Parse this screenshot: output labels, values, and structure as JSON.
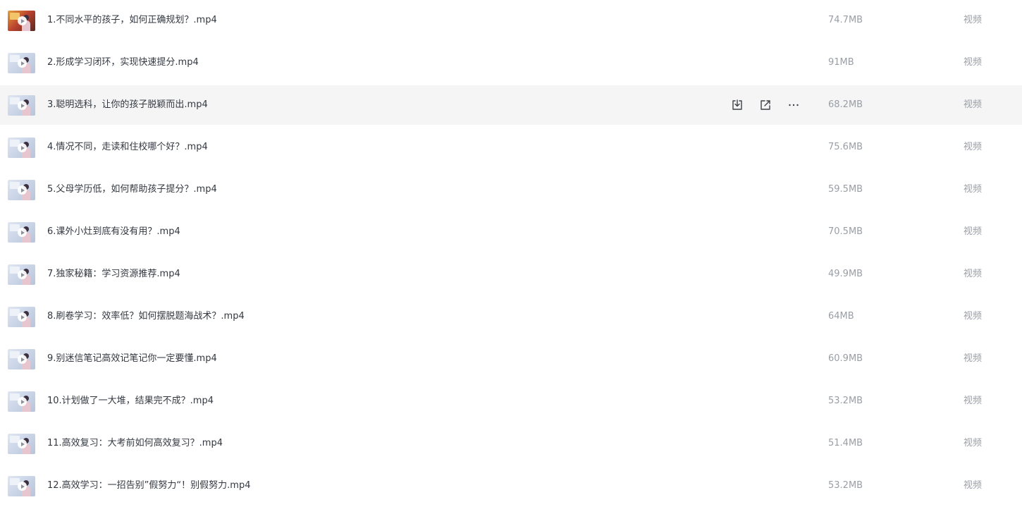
{
  "files": [
    {
      "name": "1.不同水平的孩子，如何正确规划？.mp4",
      "size": "74.7MB",
      "type": "视频",
      "thumb": "warm"
    },
    {
      "name": "2.形成学习闭环，实现快速提分.mp4",
      "size": "91MB",
      "type": "视频",
      "thumb": "cool"
    },
    {
      "name": "3.聪明选科，让你的孩子脱颖而出.mp4",
      "size": "68.2MB",
      "type": "视频",
      "thumb": "cool"
    },
    {
      "name": "4.情况不同，走读和住校哪个好？.mp4",
      "size": "75.6MB",
      "type": "视频",
      "thumb": "cool"
    },
    {
      "name": "5.父母学历低，如何帮助孩子提分？.mp4",
      "size": "59.5MB",
      "type": "视频",
      "thumb": "cool"
    },
    {
      "name": "6.课外小灶到底有没有用？.mp4",
      "size": "70.5MB",
      "type": "视频",
      "thumb": "cool"
    },
    {
      "name": "7.独家秘籍：学习资源推荐.mp4",
      "size": "49.9MB",
      "type": "视频",
      "thumb": "cool"
    },
    {
      "name": "8.刷卷学习：效率低？如何摆脱题海战术？.mp4",
      "size": "64MB",
      "type": "视频",
      "thumb": "cool"
    },
    {
      "name": "9.别迷信笔记高效记笔记你一定要懂.mp4",
      "size": "60.9MB",
      "type": "视频",
      "thumb": "cool"
    },
    {
      "name": "10.计划做了一大堆，结果完不成？.mp4",
      "size": "53.2MB",
      "type": "视频",
      "thumb": "cool"
    },
    {
      "name": "11.高效复习：大考前如何高效复习？.mp4",
      "size": "51.4MB",
      "type": "视频",
      "thumb": "cool"
    },
    {
      "name": "12.高效学习：一招告别”假努力“！别假努力.mp4",
      "size": "53.2MB",
      "type": "视频",
      "thumb": "cool"
    }
  ],
  "hovered_row": 2,
  "row_actions": [
    {
      "icon": "download-icon"
    },
    {
      "icon": "share-icon"
    },
    {
      "icon": "more-icon"
    }
  ],
  "colors": {
    "name_text": "#333840",
    "meta_text": "#999ea6",
    "hover_bg": "#f5f5f6",
    "icon": "#3d4047"
  }
}
